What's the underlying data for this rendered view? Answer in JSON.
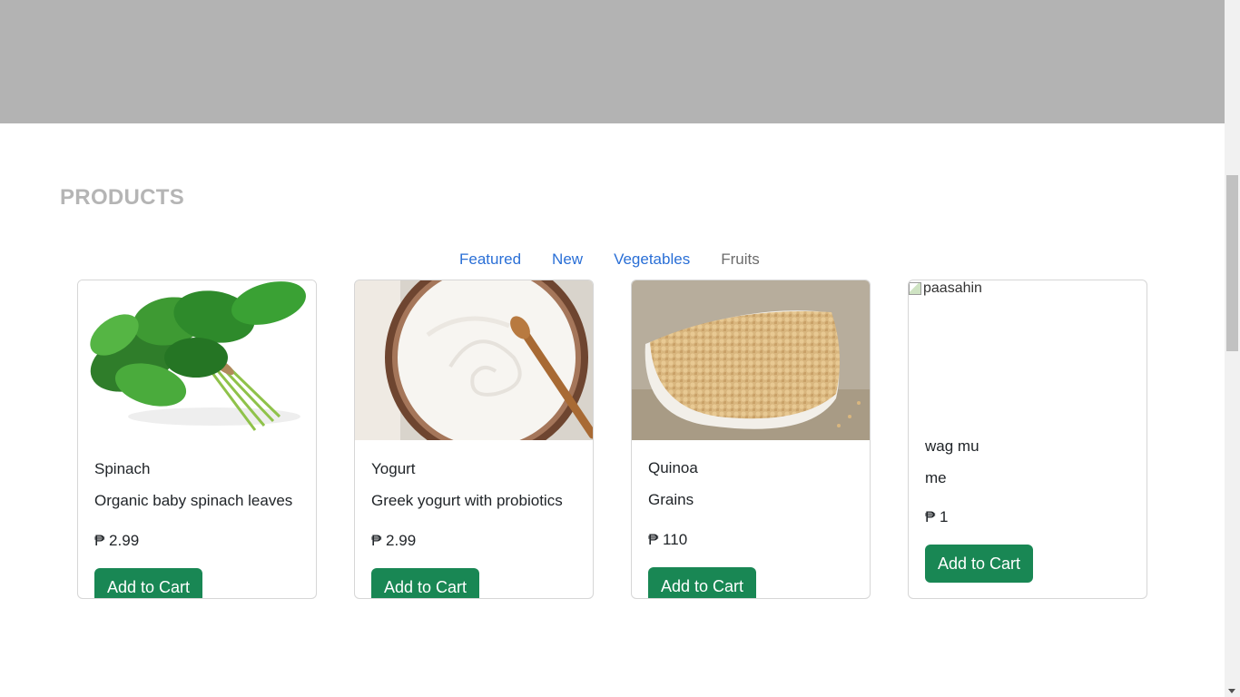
{
  "section": {
    "title": "PRODUCTS"
  },
  "tabs": [
    {
      "label": "Featured"
    },
    {
      "label": "New"
    },
    {
      "label": "Vegetables"
    },
    {
      "label": "Fruits",
      "active": true
    }
  ],
  "products": [
    {
      "name": "Spinach",
      "description": "Organic baby spinach leaves",
      "price": "₱ 2.99",
      "button": "Add to Cart",
      "image": "spinach-photo"
    },
    {
      "name": "Yogurt",
      "description": "Greek yogurt with probiotics",
      "price": "₱ 2.99",
      "button": "Add to Cart",
      "image": "yogurt-bowl-photo"
    },
    {
      "name": "Quinoa",
      "description": "Grains",
      "price": "₱ 110",
      "button": "Add to Cart",
      "image": "quinoa-bowl-photo"
    },
    {
      "name": "wag mu",
      "description": "me",
      "price": "₱ 1",
      "button": "Add to Cart",
      "image_alt": "paasahin"
    }
  ],
  "colors": {
    "banner": "#b3b3b3",
    "title": "#b5b5b5",
    "link": "#2a6fd6",
    "active_tab": "#6c6c6c",
    "button": "#198754"
  }
}
